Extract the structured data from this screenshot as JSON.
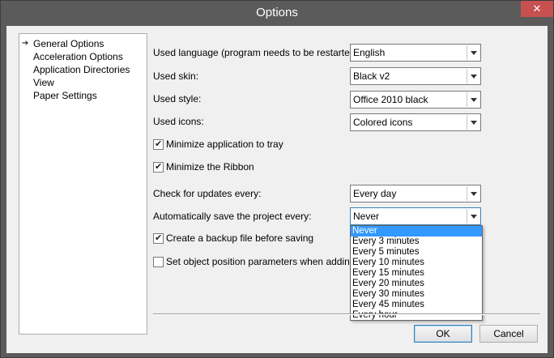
{
  "window": {
    "title": "Options",
    "close_glyph": "✕"
  },
  "nav": {
    "arrow_icon": "➔",
    "items": [
      {
        "label": "General Options"
      },
      {
        "label": "Acceleration Options"
      },
      {
        "label": "Application Directories"
      },
      {
        "label": "View"
      },
      {
        "label": "Paper Settings"
      }
    ]
  },
  "settings": {
    "language": {
      "label": "Used language (program needs to be restarted):",
      "value": "English"
    },
    "skin": {
      "label": "Used skin:",
      "value": "Black v2"
    },
    "style": {
      "label": "Used style:",
      "value": "Office 2010 black"
    },
    "icons": {
      "label": "Used icons:",
      "value": "Colored icons"
    },
    "minimize_tray": {
      "label": "Minimize application to tray",
      "checked": true
    },
    "minimize_ribbon": {
      "label": "Minimize the Ribbon",
      "checked": true
    },
    "updates": {
      "label": "Check for updates every:",
      "value": "Every day"
    },
    "autosave": {
      "label": "Automatically save the project every:",
      "value": "Never",
      "options": [
        "Never",
        "Every 3 minutes",
        "Every 5 minutes",
        "Every 10 minutes",
        "Every 15 minutes",
        "Every 20 minutes",
        "Every 30 minutes",
        "Every 45 minutes",
        "Every hour"
      ]
    },
    "backup": {
      "label": "Create a backup file before saving",
      "checked": true
    },
    "object_position": {
      "label": "Set object position parameters when adding vid",
      "checked": false
    }
  },
  "buttons": {
    "ok": "OK",
    "cancel": "Cancel"
  }
}
